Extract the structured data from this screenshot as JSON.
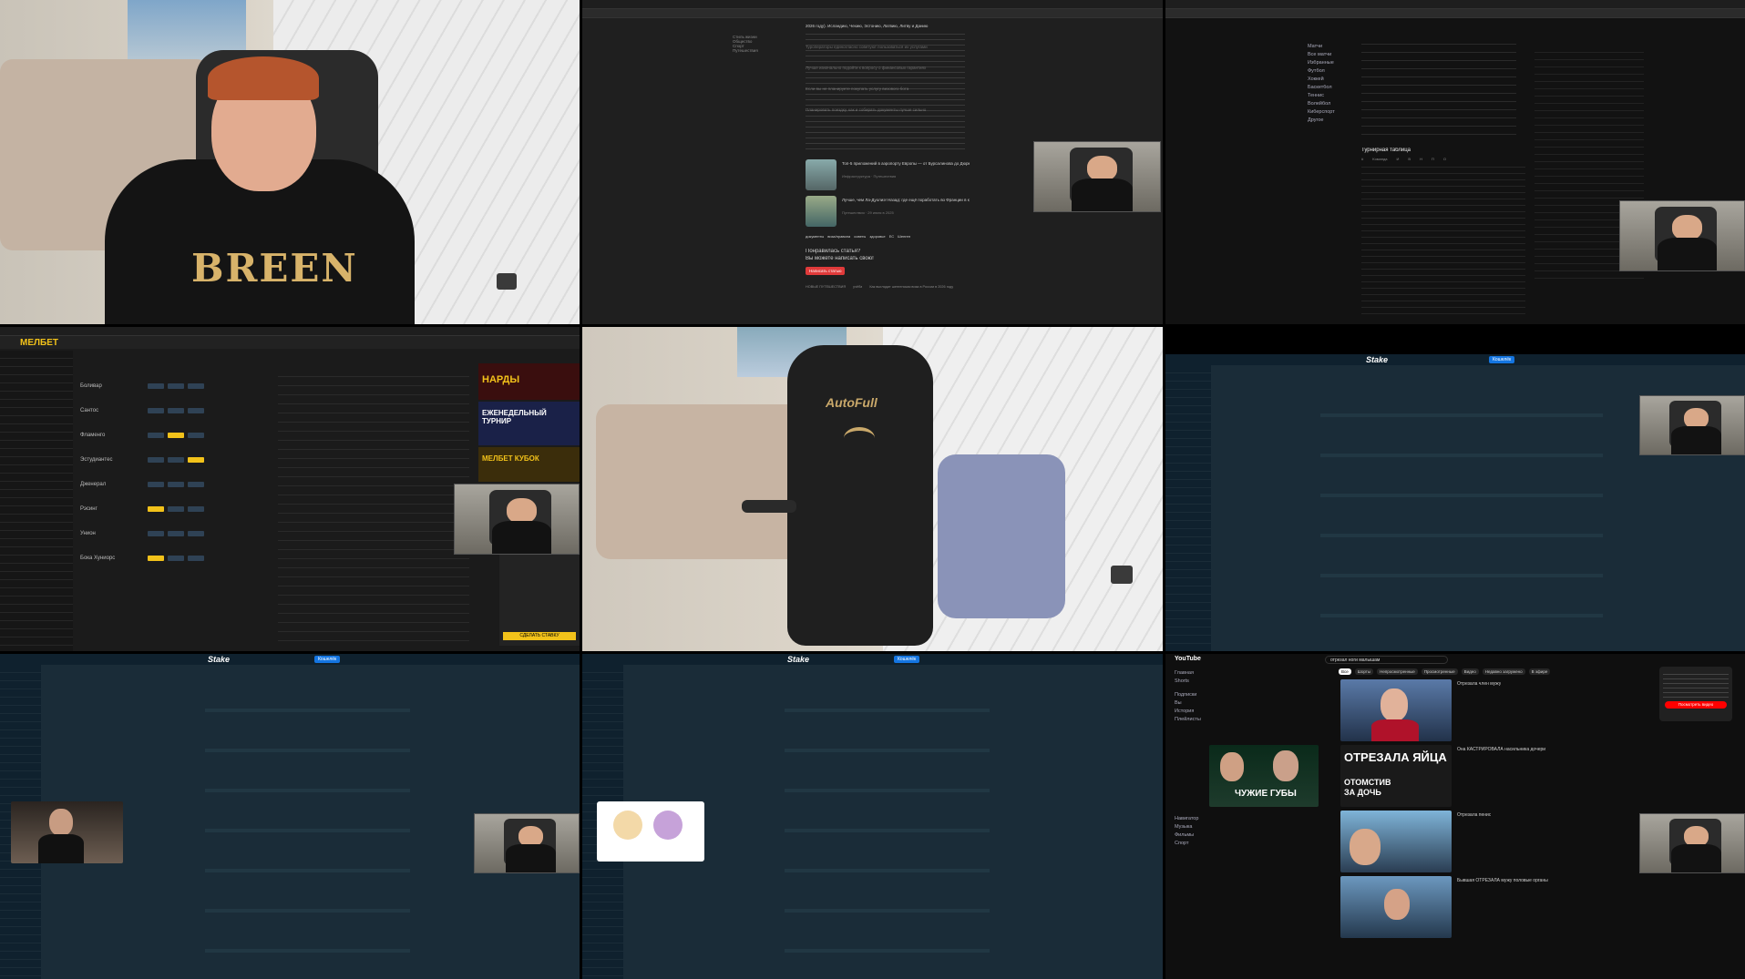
{
  "grid": {
    "tile1": {
      "name": "webcam-closeup",
      "shirt_text": "BREEN"
    },
    "tile2": {
      "name": "article-page",
      "sidebar_links": [
        "Стиль жизни",
        "Общество",
        "Спорт",
        "Путешествия"
      ],
      "paragraph_lines": [
        "2026 году). Исландию, Чехию, Эстонию, Латвию, Литву и Данию",
        "Туроператоры единогласно советуют пользоваться их услугами",
        "Лучше изначально подойти к вопросу о финансовых гарантиях",
        "Если вы не планируете покупать услугу визового бота",
        "Планировать поездку, как и собирать документы лучше сильно"
      ],
      "related": [
        {
          "title": "Топ-5 приложений в аэропорту Европы — от Бурсалинова до Дюрманэса",
          "meta": "Инфраструктура  ·  Путешествия"
        },
        {
          "title": "Лучше, чем Ла-Дуолиэ! Назад: где ещё поработать во Франции в купальный сезон",
          "meta": "Путешествия  ·  29 июля в 2025"
        }
      ],
      "tags": [
        "документы",
        "виза/правила",
        "советы",
        "здоровье",
        "ЕС",
        "Шенген"
      ],
      "cta_question": "Понравилась статья?",
      "cta_sub": "Вы можете написать свою!",
      "cta_button": "Написать статью",
      "footer_crumbs": [
        "НОВЫЕ ПУТЕШЕСТВИЯ",
        "учёба",
        "Как выглядит шенгенская виза в России в 2026 году"
      ]
    },
    "tile3": {
      "name": "sports-stats-dark",
      "section_title": "Турнирная таблица",
      "sidebar_items": [
        "Матчи",
        "Все матчи",
        "Избранные",
        "Футбол",
        "Хоккей",
        "Баскетбол",
        "Теннис",
        "Волейбол",
        "Киберспорт",
        "Другое"
      ],
      "columns": [
        "#",
        "Команда",
        "И",
        "В",
        "Н",
        "П",
        "О"
      ]
    },
    "tile4": {
      "name": "melbet-app",
      "logo": "МЕЛБЕТ",
      "promo1": "НАРДЫ",
      "promo2": "ЕЖЕНЕДЕЛЬНЫЙ ТУРНИР",
      "promo3": "МЕЛБЕТ КУБОК",
      "bet_button": "СДЕЛАТЬ СТАВКУ",
      "matches": [
        "Боливар",
        "Сантос",
        "Фламенго",
        "Эстудиантес",
        "Дженерал",
        "Рэсинг",
        "Унион",
        "Бока Хуниорс"
      ]
    },
    "tile5": {
      "name": "webcam-empty-chair",
      "chair_brand": "AutoFull"
    },
    "tile6": {
      "name": "stake-sportsbook",
      "logo": "Stake",
      "wallet_button": "Кошелёк"
    },
    "tile7": {
      "name": "stake-sportsbook-with-video",
      "logo": "Stake",
      "wallet_button": "Кошелёк"
    },
    "tile8": {
      "name": "stake-sportsbook-sticker",
      "logo": "Stake",
      "wallet_button": "Кошелёк"
    },
    "tile9": {
      "name": "youtube-page",
      "logo": "YouTube",
      "search_value": "отрезал ноги малышам",
      "chips": [
        "Все",
        "Шорты",
        "Непросмотренные",
        "Просмотренные",
        "Видео",
        "Недавно загружено",
        "В эфире"
      ],
      "thumb_texts": [
        "ОТРЕЗАЛА ЯЙЦА",
        "ОТОМСТИВ ЗА ДОЧЬ",
        "ЧУЖИЕ ГУБЫ"
      ],
      "popup_button": "Посмотреть видео",
      "video_titles": [
        "Отрезала член мужу",
        "Она КАСТРИРОВАЛА насильника дочери",
        "Отрезала пенис",
        "Бывшая ОТРЕЗАЛА мужу половые органы"
      ],
      "sidebar": [
        "Главная",
        "Shorts",
        "Подписки",
        "Вы",
        "История",
        "Плейлисты",
        "Навигатор",
        "Музыка",
        "Фильмы",
        "Спорт"
      ]
    }
  },
  "colors": {
    "melbet_yellow": "#f2c21a",
    "stake_bg": "#1a2c38",
    "stake_blue": "#1475e1",
    "youtube_red": "#ff0000",
    "article_bg": "#1f1f1f"
  }
}
